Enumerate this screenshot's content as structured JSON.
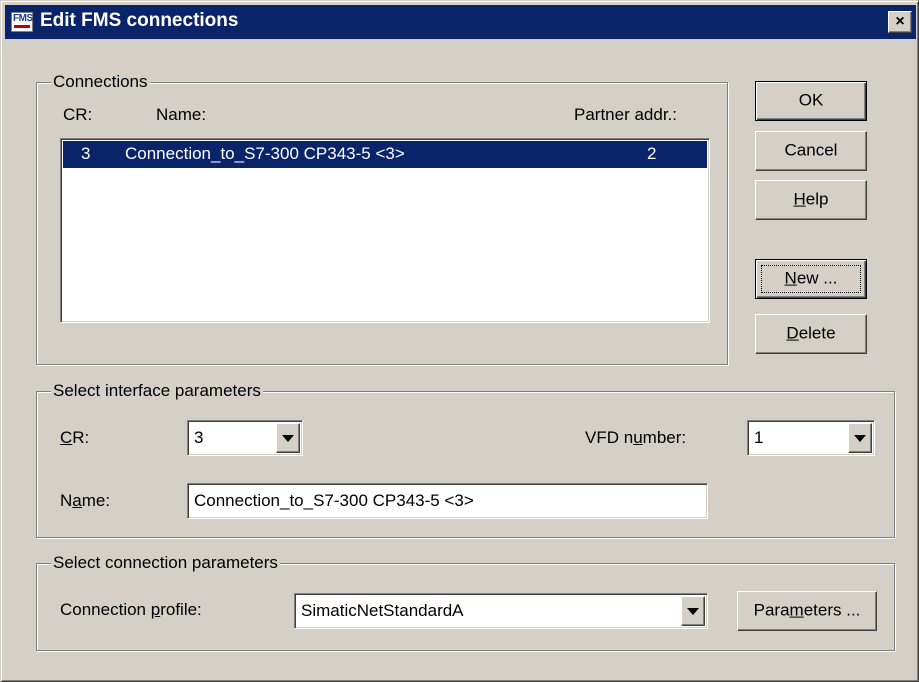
{
  "window": {
    "title": "Edit FMS connections",
    "icon": "fms-icon",
    "close_label": "×"
  },
  "connections": {
    "group_label": "Connections",
    "columns": {
      "cr": "CR:",
      "name": "Name:",
      "partner": "Partner addr.:"
    },
    "rows": [
      {
        "cr": "3",
        "name": "Connection_to_S7-300 CP343-5 <3>",
        "partner": "2",
        "selected": true
      }
    ]
  },
  "buttons": {
    "ok": "OK",
    "cancel": "Cancel",
    "help": {
      "pre": "",
      "key": "H",
      "post": "elp"
    },
    "new": {
      "pre": "",
      "key": "N",
      "post": "ew ..."
    },
    "delete": {
      "pre": "",
      "key": "D",
      "post": "elete"
    }
  },
  "interface": {
    "group_label": "Select interface parameters",
    "cr_label": {
      "pre": "",
      "key": "C",
      "post": "R:"
    },
    "cr_value": "3",
    "vfd_label": {
      "pre": "VFD n",
      "key": "u",
      "post": "mber:"
    },
    "vfd_value": "1",
    "name_label": {
      "pre": "N",
      "key": "a",
      "post": "me:"
    },
    "name_value": "Connection_to_S7-300 CP343-5 <3>"
  },
  "connection_params": {
    "group_label": "Select connection parameters",
    "profile_label": {
      "pre": "Connection ",
      "key": "p",
      "post": "rofile:"
    },
    "profile_value": "SimaticNetStandardA",
    "parameters_button": {
      "pre": "Para",
      "key": "m",
      "post": "eters ..."
    }
  },
  "colors": {
    "face": "#d4d0c8",
    "titlebar": "#0a246a",
    "selection": "#0a246a"
  }
}
